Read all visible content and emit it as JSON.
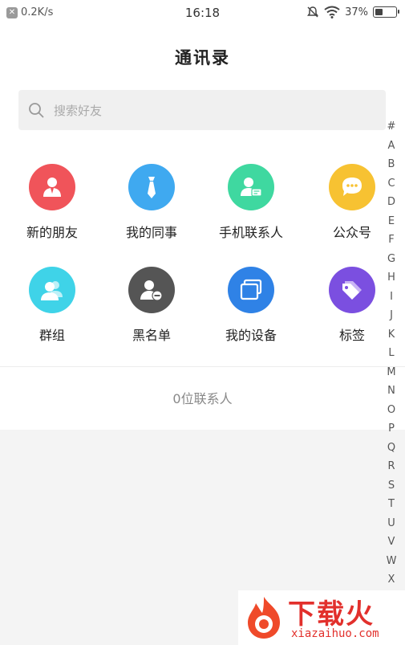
{
  "status_bar": {
    "speed": "0.2K/s",
    "time": "16:18",
    "battery_percent": "37%",
    "battery_level": 0.37
  },
  "header": {
    "title": "通讯录"
  },
  "search": {
    "placeholder": "搜索好友"
  },
  "grid": [
    {
      "label": "新的朋友",
      "icon": "new-friend-icon",
      "color": "#f0545a"
    },
    {
      "label": "我的同事",
      "icon": "tie-icon",
      "color": "#3fa9f0"
    },
    {
      "label": "手机联系人",
      "icon": "phone-contact-icon",
      "color": "#3fd8a0"
    },
    {
      "label": "公众号",
      "icon": "chat-bubble-icon",
      "color": "#f7c232"
    },
    {
      "label": "群组",
      "icon": "group-icon",
      "color": "#3fd3e8"
    },
    {
      "label": "黑名单",
      "icon": "blocked-user-icon",
      "color": "#555555"
    },
    {
      "label": "我的设备",
      "icon": "device-icon",
      "color": "#2f82e6"
    },
    {
      "label": "标签",
      "icon": "tag-icon",
      "color": "#7b4fe0"
    }
  ],
  "contacts": {
    "count_label": "0位联系人"
  },
  "index": [
    "#",
    "A",
    "B",
    "C",
    "D",
    "E",
    "F",
    "G",
    "H",
    "I",
    "J",
    "K",
    "L",
    "M",
    "N",
    "O",
    "P",
    "Q",
    "R",
    "S",
    "T",
    "U",
    "V",
    "W",
    "X"
  ],
  "watermark": {
    "brand": "下载火",
    "domain": "xiazaihuo.com"
  }
}
